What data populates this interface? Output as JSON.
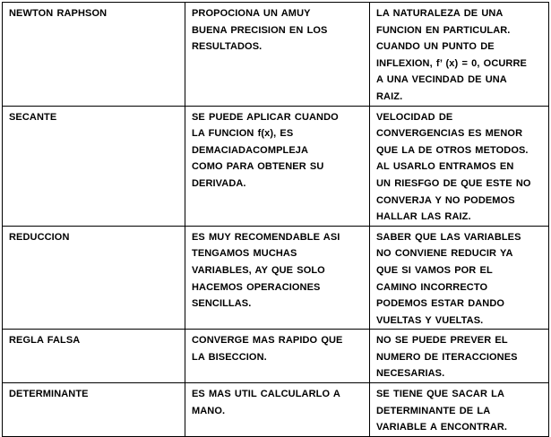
{
  "rows": [
    {
      "method": "NEWTON RAPHSON",
      "advantage": "PROPOCIONA UN AMUY\nBUENA PRECISION EN LOS\nRESULTADOS.",
      "disadvantage": "LA NATURALEZA DE UNA\nFUNCION EN PARTICULAR.\nCUANDO UN PUNTO DE\nINFLEXION, f’ (x) = 0, OCURRE\nA UNA VECINDAD DE UNA\nRAIZ."
    },
    {
      "method": "SECANTE",
      "advantage": "SE PUEDE APLICAR CUANDO\nLA FUNCION f(x), ES\nDEMACIADACOMPLEJA\nCOMO PARA OBTENER SU\nDERIVADA.",
      "disadvantage": "VELOCIDAD DE\nCONVERGENCIAS ES MENOR\nQUE LA DE OTROS METODOS.\nAL USARLO ENTRAMOS EN\nUN RIESFGO DE QUE ESTE NO\nCONVERJA Y NO PODEMOS\nHALLAR LAS RAIZ."
    },
    {
      "method": "REDUCCION",
      "advantage": "ES MUY RECOMENDABLE ASI\nTENGAMOS MUCHAS\nVARIABLES, AY QUE SOLO\nHACEMOS OPERACIONES\nSENCILLAS.",
      "disadvantage": "SABER QUE LAS VARIABLES\nNO CONVIENE REDUCIR YA\nQUE SI VAMOS POR EL\nCAMINO INCORRECTO\nPODEMOS ESTAR DANDO\nVUELTAS Y VUELTAS."
    },
    {
      "method": "REGLA FALSA",
      "advantage": "CONVERGE MAS RAPIDO QUE\nLA BISECCION.",
      "disadvantage": "NO SE PUEDE PREVER EL\nNUMERO DE ITERACCIONES\nNECESARIAS."
    },
    {
      "method": "DETERMINANTE",
      "advantage": "ES MAS UTIL CALCULARLO A\nMANO.",
      "disadvantage": "SE TIENE QUE SACAR LA\nDETERMINANTE DE LA\nVARIABLE A ENCONTRAR."
    }
  ]
}
